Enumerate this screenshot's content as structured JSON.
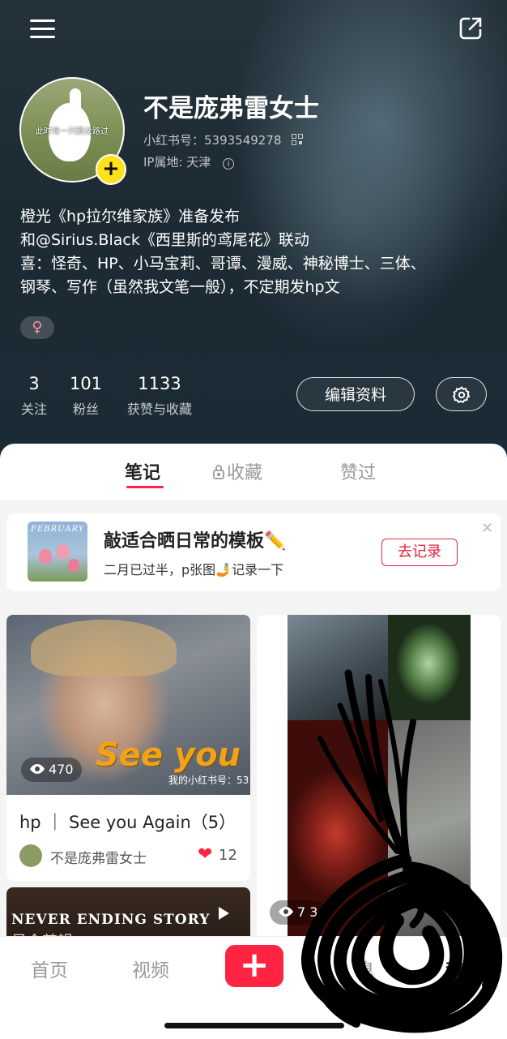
{
  "header": {
    "username": "不是庞弗雷女士",
    "red_id": "小红书号：5393549278",
    "ip_location": "IP属地: 天津",
    "avatar_caption": "此时有一只鹅女路过",
    "bio_lines": [
      "橙光《hp拉尔维家族》准备发布",
      "和@Sirius.Black《西里斯的鸢尾花》联动",
      "喜：怪奇、HP、小马宝莉、哥谭、漫威、神秘博士、三体、",
      "钢琴、写作（虽然我文笔一般），不定期发hp文"
    ],
    "gender_symbol": "♀",
    "stats": [
      {
        "value": "3",
        "label": "关注"
      },
      {
        "value": "101",
        "label": "粉丝"
      },
      {
        "value": "1133",
        "label": "获赞与收藏"
      }
    ],
    "edit_profile_label": "编辑资料"
  },
  "tabs": [
    {
      "label": "笔记",
      "active": true
    },
    {
      "label": "收藏",
      "active": false
    },
    {
      "label": "赞过",
      "active": false
    }
  ],
  "banner": {
    "image_text": "FEBRUARY",
    "title": "敲适合晒日常的模板✏️",
    "subtitle": "二月已过半，p张图🤳记录一下",
    "button_label": "去记录"
  },
  "notes": [
    {
      "overlay_text": "See you Aga",
      "watermark": "我的小红书号：53",
      "views": "470",
      "title": "hp ｜ See you Again（5）",
      "author": "不是庞弗雷女士",
      "likes": "12"
    },
    {
      "views": "7  3"
    },
    {
      "overlay_text": "NEVER ENDING STORY",
      "overlay_text_2": "是全剪辑"
    }
  ],
  "bottom_nav": {
    "items": [
      {
        "label": "首页",
        "active": false
      },
      {
        "label": "视频",
        "active": false
      },
      {
        "label": "+",
        "active": false
      },
      {
        "label": "息",
        "active": false
      },
      {
        "label": "我",
        "active": true
      }
    ]
  },
  "colors": {
    "accent": "#ff2442",
    "header_bg": "#1c2a33",
    "avatar_badge": "#ffe21c"
  }
}
